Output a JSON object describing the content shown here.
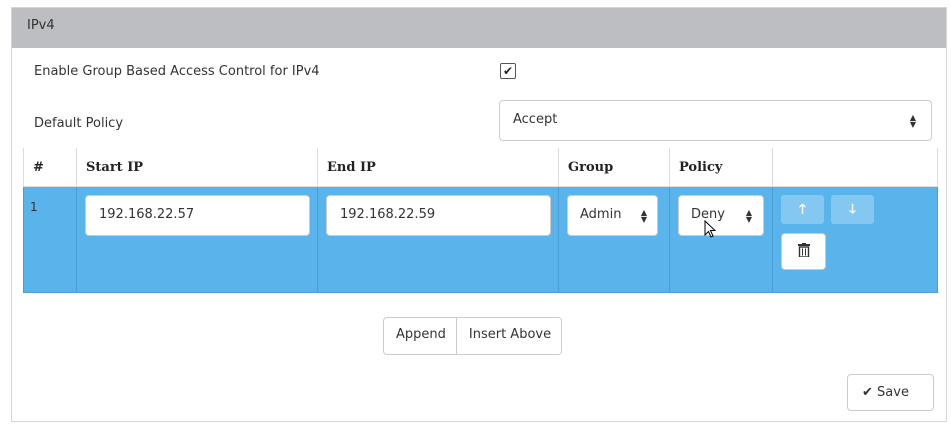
{
  "panel": {
    "title": "IPv4"
  },
  "settings": {
    "enable_label": "Enable Group Based Access Control for IPv4",
    "enable_checked": true,
    "enable_check_glyph": "✔",
    "default_policy_label": "Default Policy",
    "default_policy_value": "Accept"
  },
  "table": {
    "headers": [
      "#",
      "Start IP",
      "End IP",
      "Group",
      "Policy",
      ""
    ],
    "rows": [
      {
        "num": "1",
        "start_ip": "192.168.22.57",
        "end_ip": "192.168.22.59",
        "group": "Admin",
        "policy": "Deny"
      }
    ],
    "row_actions": {
      "up_icon": "arrow-up-icon",
      "down_icon": "arrow-down-icon",
      "delete_icon": "trash-icon"
    }
  },
  "actions": {
    "append_label": "Append",
    "insert_above_label": "Insert Above",
    "save_label": "Save",
    "save_icon": "check-icon"
  },
  "colors": {
    "header_bg": "#bdbec2",
    "selected_row": "#5ab4ec",
    "arrow_button": "#84c8f2"
  }
}
